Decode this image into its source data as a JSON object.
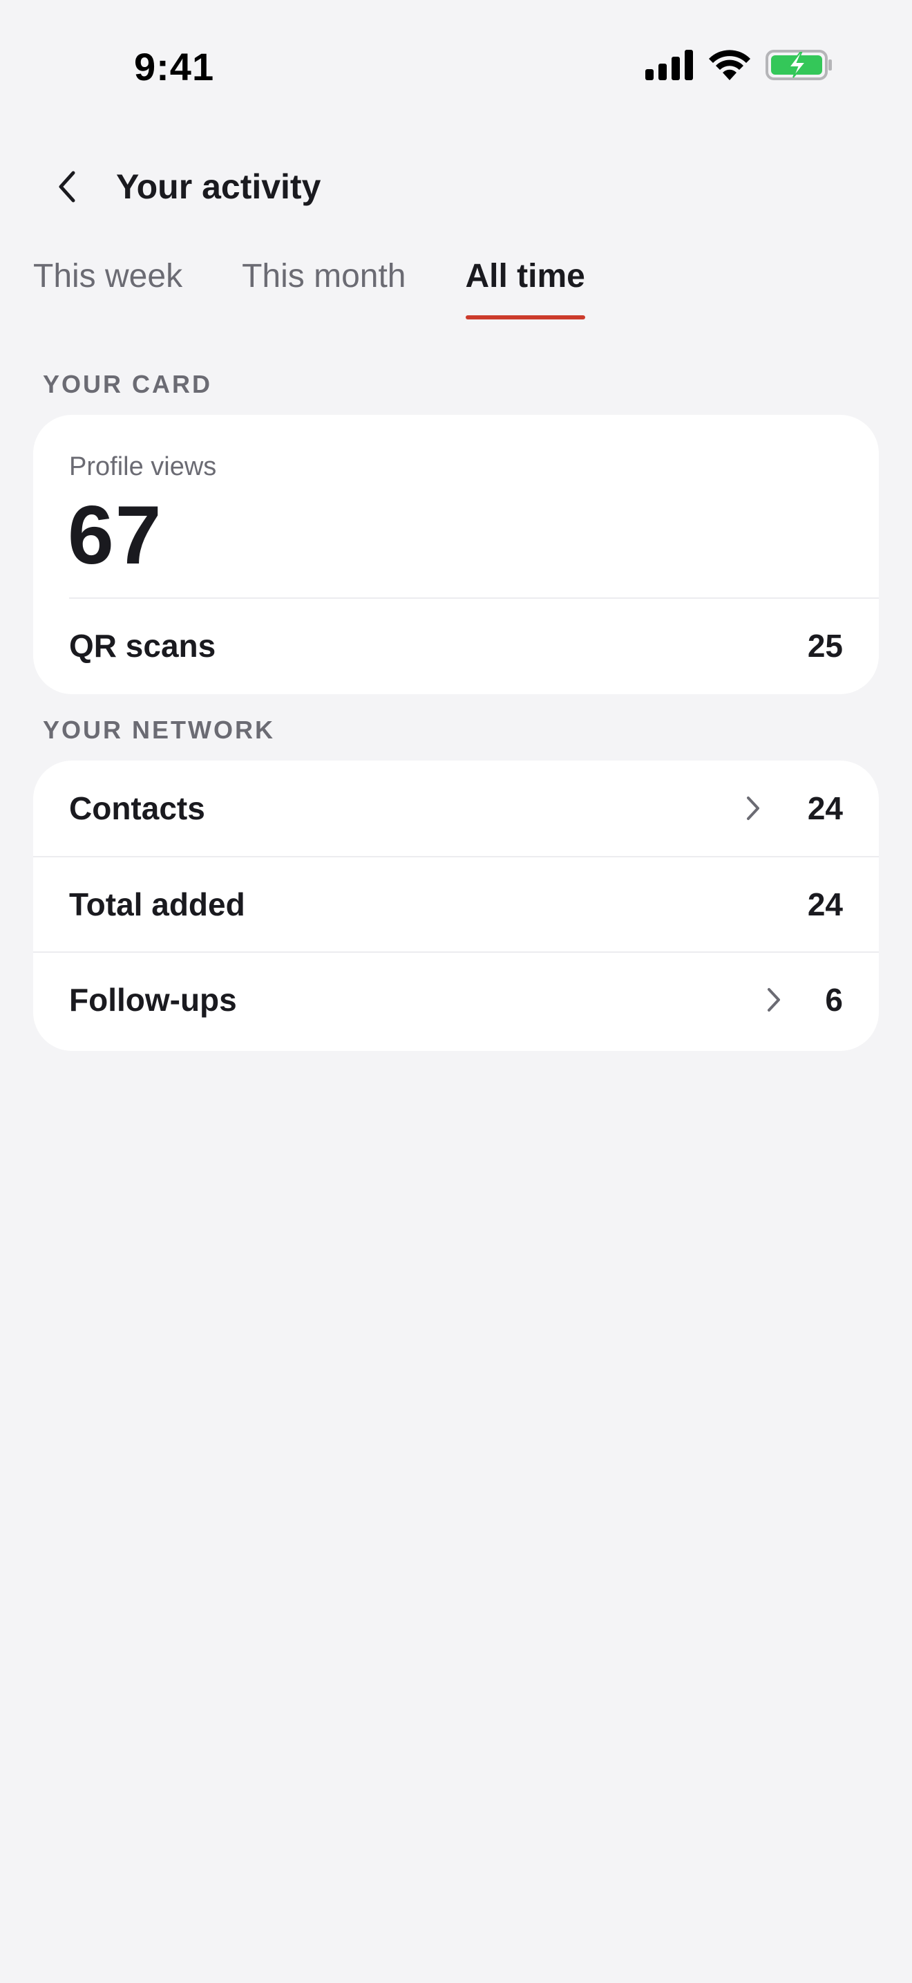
{
  "status_bar": {
    "time": "9:41",
    "icons": [
      "cellular-signal-icon",
      "wifi-icon",
      "battery-charging-icon"
    ],
    "battery_color": "#34c759"
  },
  "header": {
    "back_icon": "chevron-left-icon",
    "title": "Your activity"
  },
  "tabs": [
    {
      "label": "This week",
      "selected": false
    },
    {
      "label": "This month",
      "selected": false
    },
    {
      "label": "All time",
      "selected": true
    }
  ],
  "accent_color": "#cc3b2c",
  "your_card": {
    "section_label": "YOUR CARD",
    "profile_views": {
      "label": "Profile views",
      "value": "67"
    },
    "qr_scans": {
      "label": "QR scans",
      "value": "25"
    }
  },
  "your_network": {
    "section_label": "YOUR NETWORK",
    "rows": [
      {
        "label": "Contacts",
        "value": "24",
        "has_chevron": true
      },
      {
        "label": "Total added",
        "value": "24",
        "has_chevron": false
      },
      {
        "label": "Follow-ups",
        "value": "6",
        "has_chevron": true
      }
    ]
  }
}
